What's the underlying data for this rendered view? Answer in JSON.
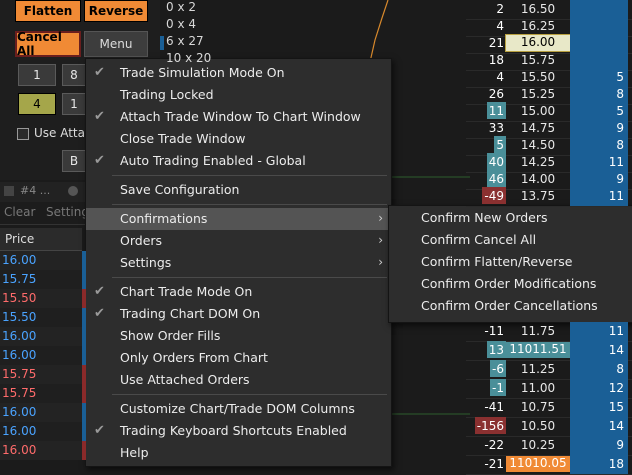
{
  "trade_panel": {
    "flatten": "Flatten",
    "reverse": "Reverse",
    "cancel_all": "Cancel All",
    "menu": "Menu",
    "qty_row1": [
      "1",
      "8"
    ],
    "qty_row2": [
      "4",
      "1"
    ],
    "attach_label": "Use Attac",
    "bottom_btn": "B"
  },
  "window_strip": {
    "tab": "#4 ...",
    "clear": "Clear",
    "settings": "Setting"
  },
  "price_list": {
    "header": "Price",
    "rows": [
      {
        "price": "16.00",
        "color": "#4aa3ff",
        "side": "#1a5f96"
      },
      {
        "price": "15.75",
        "color": "#4aa3ff",
        "side": "#1a5f96"
      },
      {
        "price": "15.50",
        "color": "#ff6b6b",
        "side": "#8a2a2a"
      },
      {
        "price": "15.50",
        "color": "#4aa3ff",
        "side": "#1a5f96"
      },
      {
        "price": "16.00",
        "color": "#4aa3ff",
        "side": "#1a5f96"
      },
      {
        "price": "16.00",
        "color": "#4aa3ff",
        "side": "#1a5f96"
      },
      {
        "price": "15.75",
        "color": "#ff6b6b",
        "side": "#8a2a2a"
      },
      {
        "price": "15.75",
        "color": "#ff6b6b",
        "side": "#8a2a2a"
      },
      {
        "price": "16.00",
        "color": "#4aa3ff",
        "side": "#1a5f96"
      },
      {
        "price": "16.00",
        "color": "#4aa3ff",
        "side": "#1a5f96"
      },
      {
        "price": "16.00",
        "color": "#ff6b6b",
        "side": "#8a2a2a"
      }
    ]
  },
  "chart_labels": [
    "0 x 2",
    "0 x 4",
    "6 x 27",
    "10 x 20"
  ],
  "dom": {
    "rows": [
      {
        "qty": "2",
        "qty_bg": "",
        "price": "16.50",
        "bid": "",
        "hl": ""
      },
      {
        "qty": "4",
        "qty_bg": "",
        "price": "16.25",
        "bid": "",
        "hl": ""
      },
      {
        "qty": "21",
        "qty_bg": "",
        "price": "16.00",
        "bid": "",
        "hl": "current"
      },
      {
        "qty": "18",
        "qty_bg": "",
        "price": "15.75",
        "bid": "",
        "hl": ""
      },
      {
        "qty": "4",
        "qty_bg": "",
        "price": "15.50",
        "bid": "5",
        "hl": ""
      },
      {
        "qty": "26",
        "qty_bg": "",
        "price": "15.25",
        "bid": "8",
        "hl": ""
      },
      {
        "qty": "11",
        "qty_bg": "teal",
        "price": "15.00",
        "bid": "5",
        "hl": ""
      },
      {
        "qty": "33",
        "qty_bg": "",
        "price": "14.75",
        "bid": "9",
        "hl": ""
      },
      {
        "qty": "5",
        "qty_bg": "teal",
        "price": "14.50",
        "bid": "8",
        "hl": ""
      },
      {
        "qty": "40",
        "qty_bg": "teal",
        "price": "14.25",
        "bid": "11",
        "hl": ""
      },
      {
        "qty": "46",
        "qty_bg": "teal",
        "price": "14.00",
        "bid": "9",
        "hl": ""
      },
      {
        "qty": "-49",
        "qty_bg": "red",
        "price": "13.75",
        "bid": "11",
        "hl": ""
      }
    ],
    "lower_rows": [
      {
        "qty": "-11",
        "qty_bg": "",
        "price": "11.75",
        "bid": "11",
        "hl": ""
      },
      {
        "qty": "13",
        "qty_bg": "teal",
        "price": "11011.51",
        "bid": "14",
        "hl": "teal"
      },
      {
        "qty": "-6",
        "qty_bg": "teal",
        "price": "11.25",
        "bid": "8",
        "hl": ""
      },
      {
        "qty": "-1",
        "qty_bg": "teal",
        "price": "11.00",
        "bid": "12",
        "hl": ""
      },
      {
        "qty": "-41",
        "qty_bg": "",
        "price": "10.75",
        "bid": "15",
        "hl": ""
      },
      {
        "qty": "-156",
        "qty_bg": "red",
        "price": "10.50",
        "bid": "14",
        "hl": ""
      },
      {
        "qty": "-22",
        "qty_bg": "",
        "price": "10.25",
        "bid": "9",
        "hl": ""
      },
      {
        "qty": "-21",
        "qty_bg": "",
        "price": "11010.05",
        "bid": "18",
        "hl": "orange"
      }
    ]
  },
  "menu": {
    "items": [
      {
        "label": "Trade Simulation Mode On",
        "checked": true
      },
      {
        "label": "Trading Locked",
        "checked": false
      },
      {
        "label": "Attach Trade Window To Chart Window",
        "checked": true
      },
      {
        "label": "Close Trade Window",
        "checked": false
      },
      {
        "label": "Auto Trading Enabled - Global",
        "checked": true
      },
      {
        "label": "Save Configuration",
        "checked": false
      },
      {
        "label": "Confirmations",
        "checked": false,
        "submenu": true
      },
      {
        "label": "Orders",
        "checked": false,
        "submenu": true
      },
      {
        "label": "Settings",
        "checked": false,
        "submenu": true
      },
      {
        "label": "Chart Trade Mode On",
        "checked": true
      },
      {
        "label": "Trading Chart DOM On",
        "checked": true
      },
      {
        "label": "Show Order Fills",
        "checked": false
      },
      {
        "label": "Only Orders From Chart",
        "checked": false
      },
      {
        "label": "Use Attached Orders",
        "checked": false
      },
      {
        "label": "Customize Chart/Trade DOM Columns",
        "checked": false
      },
      {
        "label": "Trading Keyboard Shortcuts Enabled",
        "checked": true
      },
      {
        "label": "Help",
        "checked": false
      }
    ],
    "submenu_arrow": "›"
  },
  "submenu": {
    "items": [
      "Confirm New Orders",
      "Confirm Cancel All",
      "Confirm Flatten/Reverse",
      "Confirm Order Modifications",
      "Confirm Order Cancellations"
    ]
  },
  "colors": {
    "orange": "#f08a35",
    "bid_blue": "#1a5f96",
    "teal": "#4a8f99",
    "red": "#8a3030",
    "highlight": "#545454"
  }
}
